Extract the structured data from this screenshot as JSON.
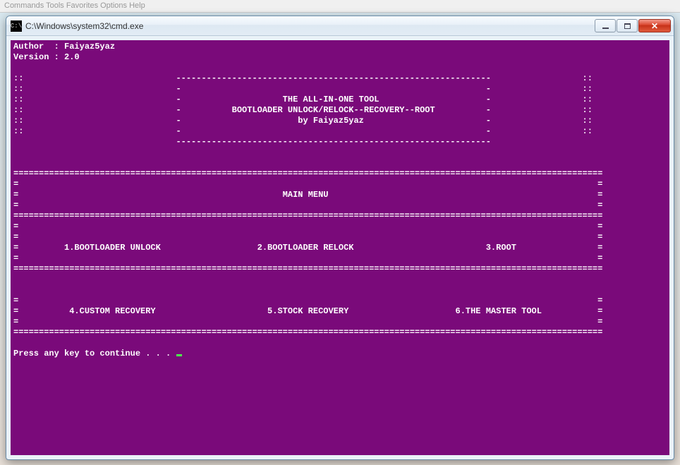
{
  "menubar_hint": "Commands  Tools  Favorites  Options  Help",
  "window": {
    "title": "C:\\Windows\\system32\\cmd.exe",
    "icon_label": "cmd-icon"
  },
  "colors": {
    "console_bg": "#7a0a7a",
    "console_fg": "#ffffff"
  },
  "header": {
    "author_label": "Author  :",
    "author": "Faiyaz5yaz",
    "version_label": "Version :",
    "version": "2.0"
  },
  "banner": {
    "line1": "THE ALL-IN-ONE TOOL",
    "line2": "BOOTLOADER UNLOCK/RELOCK--RECOVERY--ROOT",
    "line3": "by Faiyaz5yaz"
  },
  "menu_title": "MAIN MENU",
  "options": [
    {
      "n": "1",
      "label": "BOOTLOADER UNLOCK"
    },
    {
      "n": "2",
      "label": "BOOTLOADER RELOCK"
    },
    {
      "n": "3",
      "label": "ROOT"
    },
    {
      "n": "4",
      "label": "CUSTOM RECOVERY"
    },
    {
      "n": "5",
      "label": "STOCK RECOVERY"
    },
    {
      "n": "6",
      "label": "THE MASTER TOOL"
    }
  ],
  "prompt": "Press any key to continue . . . "
}
